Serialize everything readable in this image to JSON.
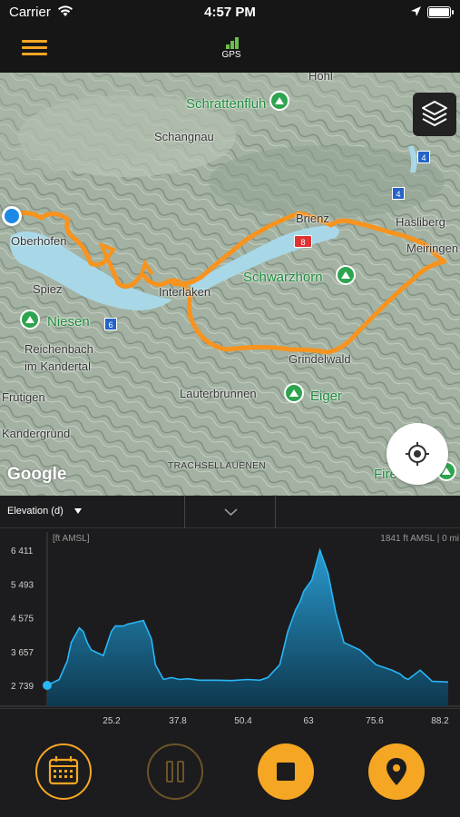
{
  "status_bar": {
    "carrier": "Carrier",
    "time": "4:57 PM"
  },
  "top_bar": {
    "gps_label": "GPS",
    "gps_color": "#6cc04a",
    "accent": "#f5a623"
  },
  "map": {
    "places": {
      "hohl": "Hohl",
      "schrattenfluh": "Schrattenfluh",
      "schangnau": "Schangnau",
      "brienz": "Brienz",
      "hasliberg": "Hasliberg",
      "meiringen": "Meiringen",
      "oberhofen": "Oberhofen",
      "spiez": "Spiez",
      "niesen": "Niesen",
      "interlaken": "Interlaken",
      "schwarzhorn": "Schwarzhorn",
      "reichenbach": "Reichenbach",
      "im_kandertal": "im Kandertal",
      "grindelwald": "Grindelwald",
      "frutigen": "Frutigen",
      "lauterbrunnen": "Lauterbrunnen",
      "eiger": "Eiger",
      "kandergrund": "Kandergrund",
      "trachsellauenen": "TRACHSELLAUENEN",
      "fire": "Fire"
    },
    "road_numbers": [
      "4",
      "4",
      "6",
      "8"
    ],
    "google_logo": "Google",
    "route_color": "#f7931e"
  },
  "chart_header": {
    "metric": "Elevation (d)"
  },
  "chart_data": {
    "type": "area",
    "unit_label": "[ft AMSL]",
    "readout": "1841 ft AMSL | 0 mi",
    "y_ticks": [
      "6 411",
      "5 493",
      "4 575",
      "3 657",
      "2 739"
    ],
    "x_ticks": [
      "25.2",
      "37.8",
      "50.4",
      "63",
      "75.6",
      "88.2"
    ],
    "ylim": [
      2739,
      6411
    ],
    "xlim": [
      0,
      100
    ],
    "x": [
      0,
      3,
      5,
      6,
      8,
      9,
      10,
      11,
      13,
      14,
      16,
      17,
      19,
      20,
      22,
      24,
      26,
      27,
      29,
      31,
      33,
      35,
      38,
      42,
      46,
      50,
      53,
      55,
      58,
      60,
      62,
      63,
      64,
      66,
      67,
      68,
      70,
      72,
      74,
      78,
      82,
      86,
      87,
      88,
      89,
      90,
      93,
      96,
      100
    ],
    "y": [
      2739,
      2900,
      3400,
      3900,
      4300,
      4200,
      3900,
      3700,
      3600,
      3550,
      4200,
      4350,
      4350,
      4400,
      4450,
      4500,
      4000,
      3300,
      2900,
      2950,
      2900,
      2920,
      2880,
      2880,
      2870,
      2900,
      2880,
      2950,
      3300,
      4200,
      4800,
      5000,
      5300,
      5600,
      6000,
      6411,
      5800,
      4700,
      3900,
      3700,
      3300,
      3150,
      3100,
      3050,
      2950,
      2900,
      3150,
      2850,
      2830
    ]
  },
  "bottom_bar": {
    "buttons": [
      "calendar",
      "pause",
      "stop",
      "location"
    ]
  }
}
